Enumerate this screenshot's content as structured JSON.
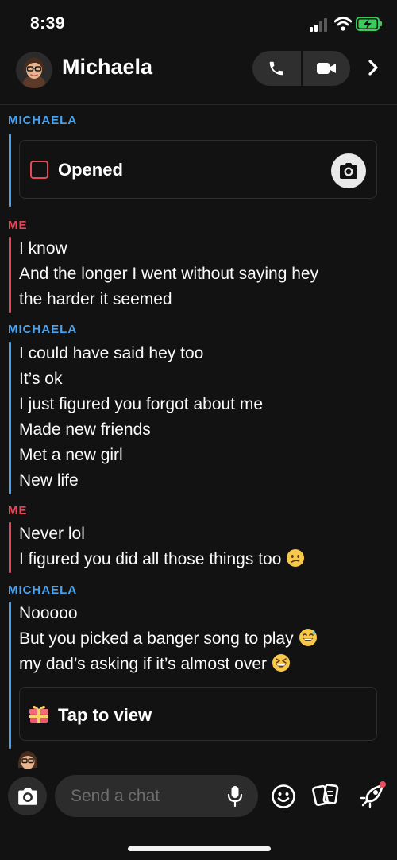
{
  "status_bar": {
    "time": "8:39"
  },
  "header": {
    "name": "Michaela"
  },
  "conversation": {
    "sender_her": "MICHAELA",
    "sender_me": "ME",
    "snap_status": "Opened",
    "group1_me": [
      "I know",
      "And the longer I went without saying hey",
      "the harder it seemed"
    ],
    "group2_her": [
      "I could have said hey too",
      "It’s ok",
      "I just figured you forgot about me",
      "Made new friends",
      "Met a new girl",
      "New life"
    ],
    "group3_me": [
      "Never lol",
      "I figured you did all those things too"
    ],
    "group4_her": [
      "Nooooo",
      "But you picked a banger song to play",
      "my dad’s asking if it’s almost over"
    ],
    "gift_label": "Tap to view"
  },
  "composer": {
    "placeholder": "Send a chat"
  },
  "colors": {
    "her": "#4aa3ef",
    "me": "#e8475a",
    "background": "#121212"
  }
}
